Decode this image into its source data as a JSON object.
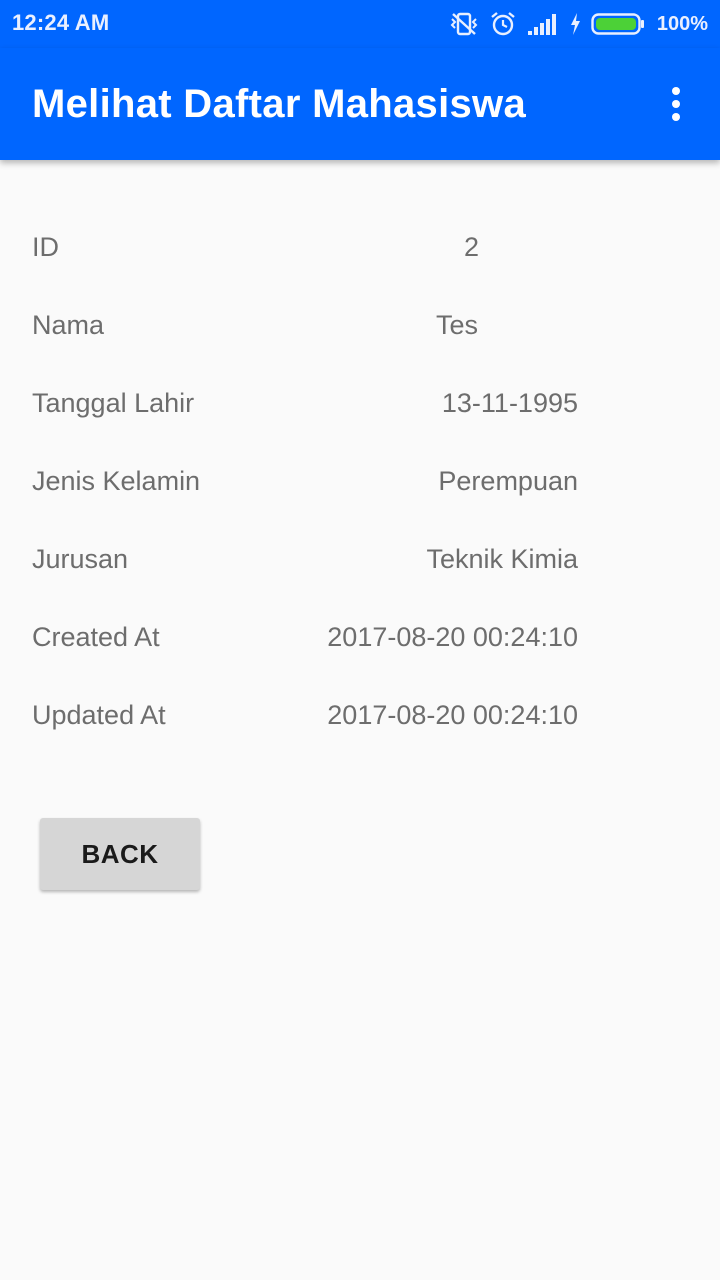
{
  "status_bar": {
    "time": "12:24 AM",
    "battery": "100%",
    "icons": [
      "vibrate-off-icon",
      "alarm-icon",
      "signal-icon",
      "charging-icon",
      "battery-icon"
    ]
  },
  "app_bar": {
    "title": "Melihat Daftar Mahasiswa",
    "menu_icon": "more-vert-icon"
  },
  "details": {
    "rows": [
      {
        "label": "ID",
        "value": "2"
      },
      {
        "label": "Nama",
        "value": "Tes"
      },
      {
        "label": "Tanggal Lahir",
        "value": "13-11-1995"
      },
      {
        "label": "Jenis Kelamin",
        "value": "Perempuan"
      },
      {
        "label": "Jurusan",
        "value": "Teknik Kimia"
      },
      {
        "label": "Created At",
        "value": "2017-08-20 00:24:10"
      },
      {
        "label": "Updated At",
        "value": "2017-08-20 00:24:10"
      }
    ]
  },
  "actions": {
    "back_label": "BACK"
  },
  "colors": {
    "primary": "#0066ff",
    "background": "#fafafa",
    "text_secondary": "#6d6d6d",
    "button": "#d6d6d6"
  }
}
